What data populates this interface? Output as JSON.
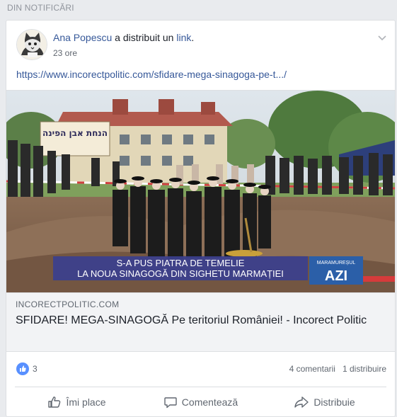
{
  "section": {
    "label": "DIN NOTIFICĂRI"
  },
  "post": {
    "author": "Ana Popescu",
    "action_text": " a distribuit un ",
    "action_link": "link",
    "period": ".",
    "time": "23 ore",
    "url": "https://www.incorectpolitic.com/sfidare-mega-sinagoga-pe-t.../"
  },
  "preview": {
    "banner_text": "הנחת אבן הפינה",
    "caption_line1": "S-A PUS PIATRA DE TEMELIE",
    "caption_line2": "LA NOUA SINAGOGĂ DIN SIGHETU MARMAȚIEI",
    "logo_top": "MARAMUREȘUL",
    "logo_main": "AZI"
  },
  "link_card": {
    "domain": "INCORECTPOLITIC.COM",
    "title": "SFIDARE! MEGA-SINAGOGĂ Pe teritoriul României! - Incorect Politic"
  },
  "stats": {
    "likes": "3",
    "comments": "4 comentarii",
    "shares": "1 distribuire"
  },
  "actions": {
    "like": "Îmi place",
    "comment": "Comentează",
    "share": "Distribuie"
  },
  "colors": {
    "link": "#365899",
    "like_badge": "#5890ff",
    "caption_band": "#3b3f8e"
  }
}
